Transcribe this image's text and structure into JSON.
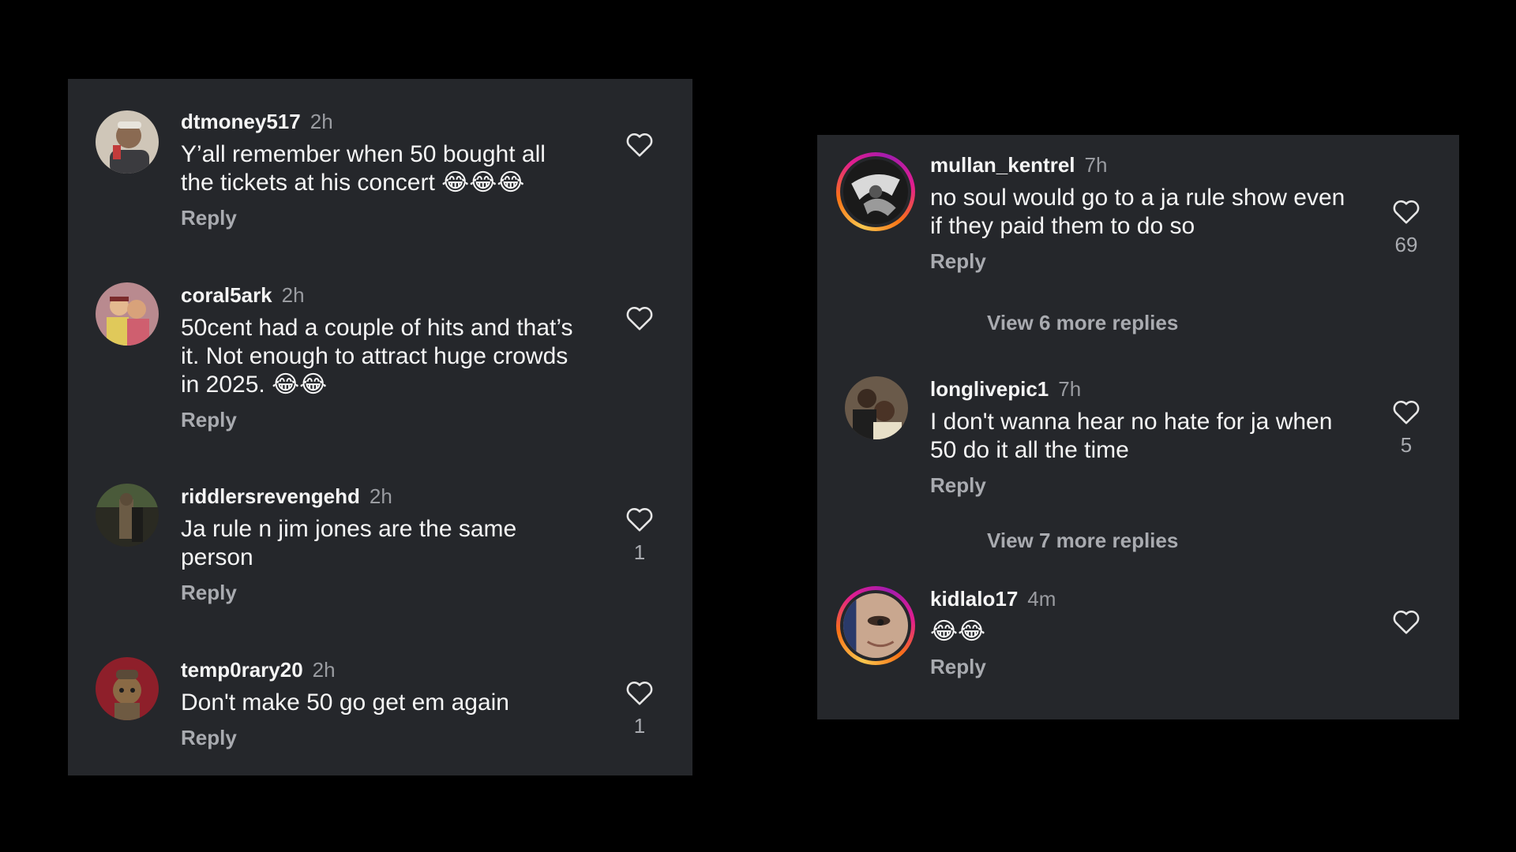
{
  "left_panel": {
    "comments": [
      {
        "username": "dtmoney517",
        "time": "2h",
        "text": "Y’all remember when 50 bought all the tickets at his concert 😂😂😂",
        "reply_label": "Reply",
        "like_count": ""
      },
      {
        "username": "coral5ark",
        "time": "2h",
        "text": "50cent had a couple of hits and that’s it. Not enough to attract huge crowds in 2025. 😂😂",
        "reply_label": "Reply",
        "like_count": ""
      },
      {
        "username": "riddlersrevengehd",
        "time": "2h",
        "text": "Ja rule n jim jones are the same person",
        "reply_label": "Reply",
        "like_count": "1"
      },
      {
        "username": "temp0rary20",
        "time": "2h",
        "text": "Don't make 50 go get em again",
        "reply_label": "Reply",
        "like_count": "1"
      }
    ]
  },
  "right_panel": {
    "comments": [
      {
        "username": "mullan_kentrel",
        "time": "7h",
        "text": "no soul would go to a ja rule show even if they paid them to do so",
        "reply_label": "Reply",
        "like_count": "69",
        "view_more": "View 6 more replies"
      },
      {
        "username": "longlivepic1",
        "time": "7h",
        "text": "I don't wanna hear no hate for ja when 50 do it all the time",
        "reply_label": "Reply",
        "like_count": "5",
        "view_more": "View 7 more replies"
      },
      {
        "username": "kidlalo17",
        "time": "4m",
        "text": "😂😂",
        "reply_label": "Reply",
        "like_count": ""
      }
    ]
  },
  "colors": {
    "background": "#000000",
    "panel": "#25272b",
    "primary_text": "#f5f5f5",
    "secondary_text": "#a9abb0",
    "story_ring": "#e11d8f"
  }
}
